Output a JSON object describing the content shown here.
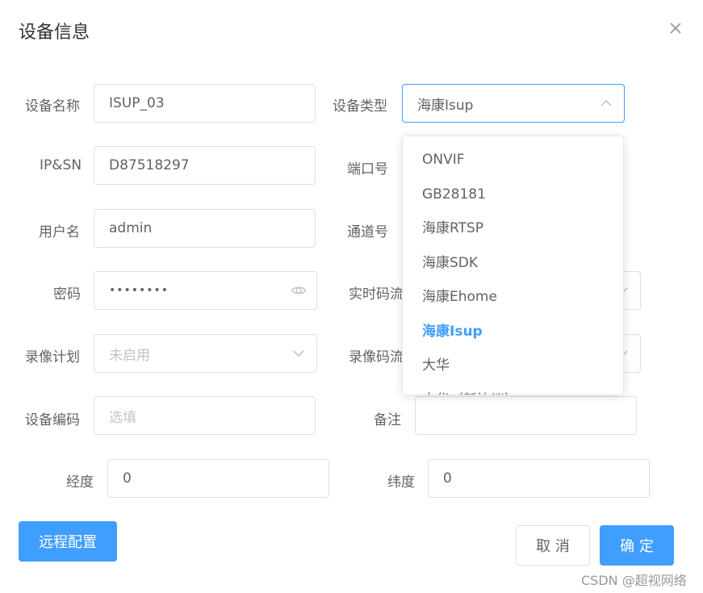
{
  "dialog": {
    "title": "设备信息"
  },
  "form": {
    "device_name_label": "设备名称",
    "device_name_value": "ISUP_03",
    "device_type_label": "设备类型",
    "device_type_value": "海康Isup",
    "ip_sn_label": "IP&SN",
    "ip_sn_value": "D87518297",
    "port_label": "端口号",
    "username_label": "用户名",
    "username_value": "admin",
    "channel_label": "通道号",
    "password_label": "密码",
    "password_value": "••••••••",
    "realtime_stream_label": "实时码流",
    "record_plan_label": "录像计划",
    "record_plan_value": "未启用",
    "record_stream_label": "录像码流",
    "device_code_label": "设备编码",
    "device_code_placeholder": "选填",
    "remark_label": "备注",
    "longitude_label": "经度",
    "longitude_value": "0",
    "latitude_label": "纬度",
    "latitude_value": "0"
  },
  "dropdown": {
    "options": [
      "ONVIF",
      "GB28181",
      "海康RTSP",
      "海康SDK",
      "海康Ehome",
      "海康Isup",
      "大华",
      "大华（新协议）"
    ],
    "selected": "海康Isup"
  },
  "buttons": {
    "remote_config": "远程配置",
    "cancel": "取 消",
    "confirm": "确 定"
  },
  "watermark": "CSDN @超视网络",
  "colors": {
    "primary": "#409eff",
    "border": "#dcdfe6",
    "text": "#606266",
    "placeholder": "#c0c4cc"
  }
}
